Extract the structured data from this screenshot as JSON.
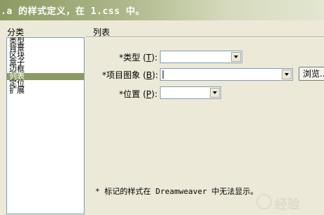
{
  "window": {
    "title": ".a 的样式定义，在 1.css 中。"
  },
  "category": {
    "label": "分类",
    "items": [
      "类型",
      "背景",
      "区块",
      "盒子",
      "边框",
      "列表",
      "定位",
      "扩展"
    ],
    "selected": "列表"
  },
  "panel": {
    "title": "列表",
    "fields": {
      "type": {
        "label": "*类型 ",
        "key": "T",
        "suffix": ":",
        "value": ""
      },
      "image": {
        "label": "*项目图象 ",
        "key": "B",
        "suffix": ":",
        "value": ""
      },
      "position": {
        "label": "*位置 ",
        "key": "P",
        "suffix": ":",
        "value": ""
      }
    },
    "browse_label": "浏览...",
    "note": "* 标记的样式在 Dreamweaver 中无法显示。"
  },
  "watermark": {
    "text": "经验"
  },
  "colors": {
    "accent": "#8c9b64",
    "dialog_bg": "#ece9d8"
  }
}
